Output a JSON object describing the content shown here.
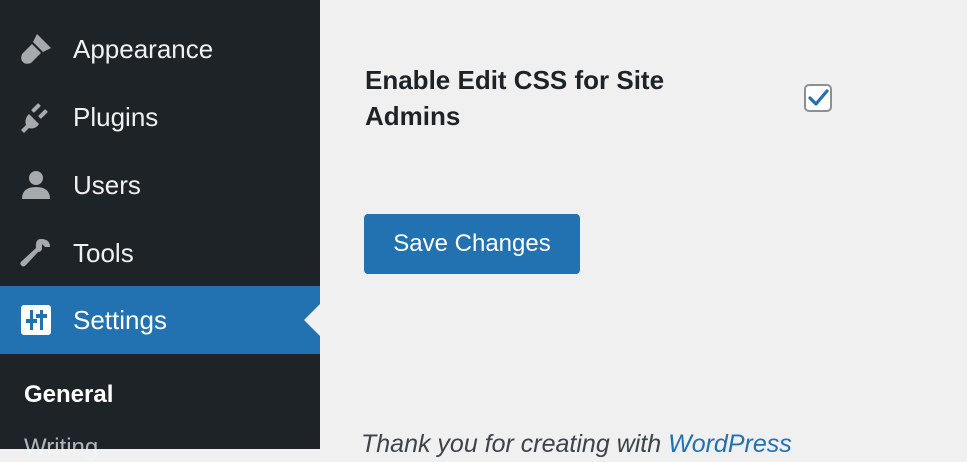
{
  "sidebar": {
    "menu": [
      {
        "label": "Appearance",
        "icon": "paintbrush-icon"
      },
      {
        "label": "Plugins",
        "icon": "plug-icon"
      },
      {
        "label": "Users",
        "icon": "user-icon"
      },
      {
        "label": "Tools",
        "icon": "wrench-icon"
      },
      {
        "label": "Settings",
        "icon": "settings-sliders-icon",
        "active": true
      }
    ],
    "submenu": [
      {
        "label": "General",
        "current": true
      },
      {
        "label": "Writing"
      }
    ]
  },
  "main": {
    "setting_label": "Enable Edit CSS for Site Admins",
    "checkbox_checked": true,
    "save_button": "Save Changes",
    "footer_prefix": "Thank you for creating with ",
    "footer_link": "WordPress"
  },
  "colors": {
    "sidebar_bg": "#1d2327",
    "accent": "#2271b1",
    "page_bg": "#f0f0f1"
  }
}
